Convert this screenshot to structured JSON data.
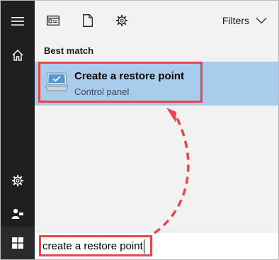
{
  "app": {
    "name": "Windows Start search"
  },
  "toolbar": {
    "filters_label": "Filters",
    "icons": [
      "app-window-icon",
      "document-icon",
      "gear-icon"
    ]
  },
  "rail": {
    "icons": [
      "hamburger-menu-icon",
      "home-icon",
      "settings-gear-icon",
      "people-icon",
      "windows-start-icon"
    ]
  },
  "results": {
    "section_title": "Best match",
    "best_match": {
      "title": "Create a restore point",
      "subtitle": "Control panel",
      "icon": "restore-point-pc-icon"
    }
  },
  "search": {
    "value": "create a restore point"
  },
  "colors": {
    "rail_bg": "#1f1f1f",
    "selection_bg": "#a9cbec",
    "annotation": "#e5474b"
  }
}
